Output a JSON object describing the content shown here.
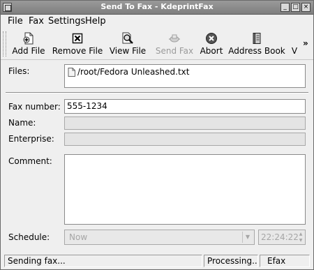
{
  "window": {
    "title": "Send To Fax - KdeprintFax",
    "controls": {
      "minimize": "_",
      "maximize": "□",
      "close": "×"
    }
  },
  "menubar": {
    "items": [
      {
        "label": "File"
      },
      {
        "label": "Fax"
      },
      {
        "label": "Settings"
      },
      {
        "label": "Help"
      }
    ]
  },
  "toolbar": {
    "buttons": [
      {
        "label": "Add File",
        "icon": "add-file-icon",
        "enabled": true
      },
      {
        "label": "Remove File",
        "icon": "remove-file-icon",
        "enabled": true
      },
      {
        "label": "View File",
        "icon": "view-file-icon",
        "enabled": true
      },
      {
        "label": "Send Fax",
        "icon": "send-fax-icon",
        "enabled": false
      },
      {
        "label": "Abort",
        "icon": "abort-icon",
        "enabled": true
      },
      {
        "label": "Address Book",
        "icon": "address-book-icon",
        "enabled": true
      },
      {
        "label": "V",
        "icon": "",
        "enabled": true
      }
    ],
    "overflow": "»"
  },
  "form": {
    "files_label": "Files:",
    "files": [
      "/root/Fedora Unleashed.txt"
    ],
    "fax_number_label": "Fax number:",
    "fax_number": "555-1234",
    "name_label": "Name:",
    "name": "",
    "enterprise_label": "Enterprise:",
    "enterprise": "",
    "comment_label": "Comment:",
    "comment": "",
    "schedule_label": "Schedule:",
    "schedule": "Now",
    "time": "22:24:22"
  },
  "status": {
    "message": "Sending fax...",
    "state": "Processing...",
    "service": "Efax"
  }
}
